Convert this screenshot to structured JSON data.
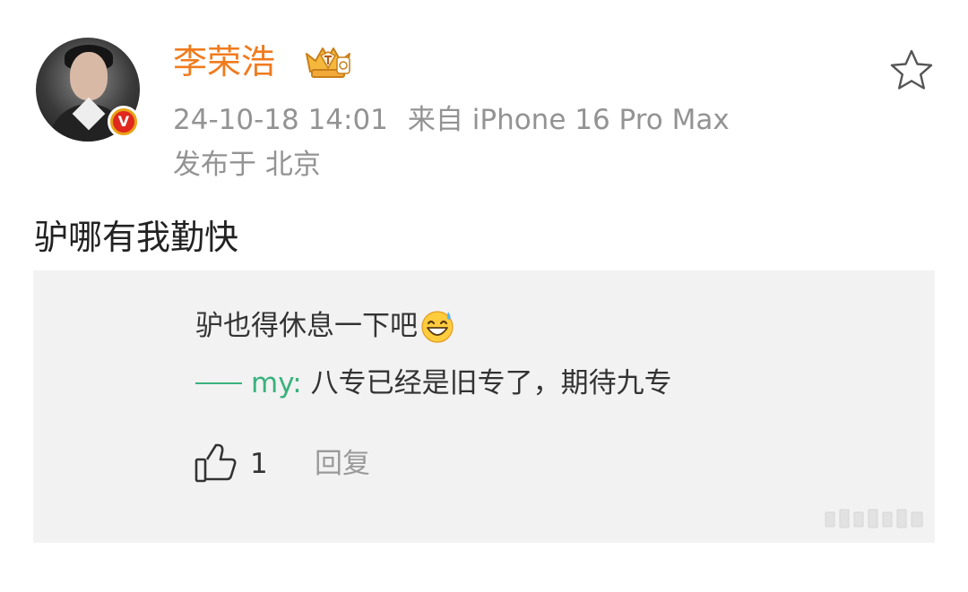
{
  "author": {
    "name": "李荣浩",
    "verified_badge": "V",
    "crown_icon": "crown-badge-icon"
  },
  "post": {
    "timestamp": "24-10-18 14:01",
    "source": "来自 iPhone 16 Pro Max",
    "location": "发布于 北京",
    "text": "驴哪有我勤快"
  },
  "quoted_comment": {
    "text": "驴也得休息一下吧",
    "emoji": "grinning-sweat-emoji",
    "reply_user": "my:",
    "reply_text": "八专已经是旧专了，期待九专",
    "like_count": "1",
    "reply_label": "回复"
  },
  "icons": {
    "star": "star-outline-icon",
    "like": "thumbs-up-icon"
  },
  "colors": {
    "username": "#f07b1d",
    "reply_user": "#39b27c",
    "meta": "#939393",
    "quote_bg": "#f2f2f2",
    "verified": "#e0281e"
  }
}
